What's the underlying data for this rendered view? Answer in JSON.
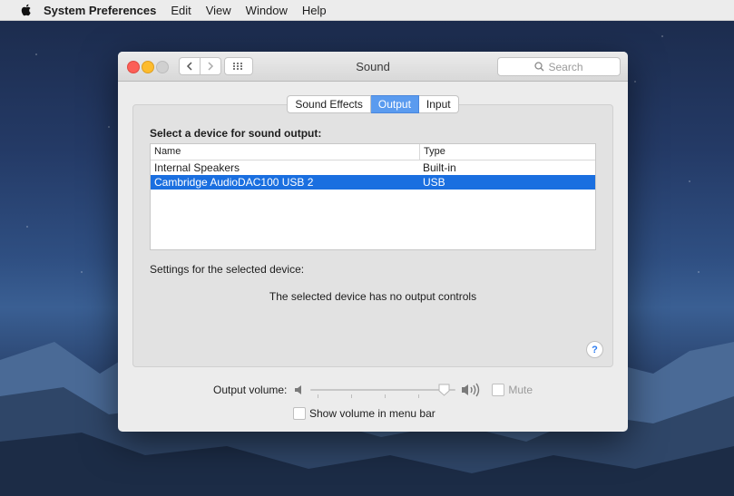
{
  "menubar": {
    "app_name": "System Preferences",
    "items": [
      "Edit",
      "View",
      "Window",
      "Help"
    ]
  },
  "window": {
    "title": "Sound",
    "search_placeholder": "Search"
  },
  "tabs": [
    {
      "label": "Sound Effects",
      "active": false
    },
    {
      "label": "Output",
      "active": true
    },
    {
      "label": "Input",
      "active": false
    }
  ],
  "output": {
    "heading": "Select a device for sound output:",
    "columns": {
      "name": "Name",
      "type": "Type"
    },
    "devices": [
      {
        "name": "Internal Speakers",
        "type": "Built-in",
        "selected": false
      },
      {
        "name": "Cambridge AudioDAC100 USB 2",
        "type": "USB",
        "selected": true
      }
    ],
    "settings_label": "Settings for the selected device:",
    "no_controls_text": "The selected device has no output controls",
    "help_label": "?"
  },
  "volume": {
    "label": "Output volume:",
    "level": 0.96,
    "mute_label": "Mute",
    "mute_checked": false,
    "show_in_menu_bar_label": "Show volume in menu bar",
    "show_in_menu_bar_checked": false
  },
  "colors": {
    "selection": "#1a6fe0",
    "active_tab": "#5a9bef",
    "help_blue": "#2b7bf0"
  }
}
